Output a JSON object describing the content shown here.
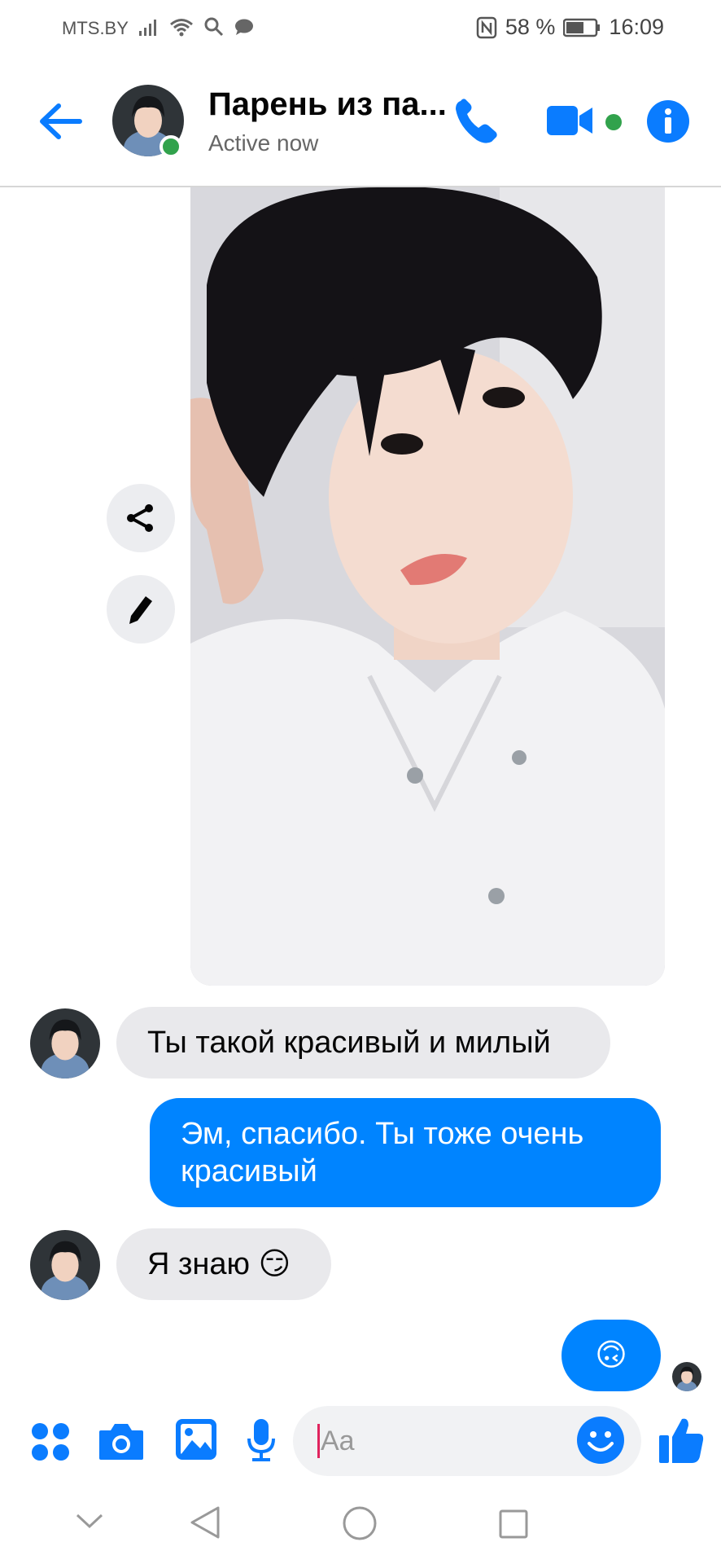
{
  "status_bar": {
    "carrier": "MTS.BY",
    "battery": "58 %",
    "time": "16:09"
  },
  "header": {
    "back_icon": "arrow-left-icon",
    "contact_name": "Парень из па...",
    "presence": "Active now",
    "call_icon": "phone-icon",
    "video_icon": "video-camera-icon",
    "info_icon": "info-icon"
  },
  "photo_actions": {
    "share_icon": "share-icon",
    "edit_icon": "pencil-icon"
  },
  "messages": [
    {
      "direction": "incoming",
      "text": "Ты такой красивый и милый"
    },
    {
      "direction": "outgoing",
      "line1": "Эм, спасибо. Ты тоже очень",
      "line2": "красивый"
    },
    {
      "direction": "incoming",
      "text": "Я знаю 😏"
    },
    {
      "direction": "outgoing",
      "text": "🙃"
    }
  ],
  "composer": {
    "placeholder": "Aa",
    "icons": [
      "apps-icon",
      "camera-icon",
      "gallery-icon",
      "microphone-icon",
      "emoji-icon",
      "thumbs-up-icon"
    ]
  },
  "colors": {
    "accent": "#0084ff",
    "online": "#31a24c",
    "incoming_bubble": "#e9e9ec"
  }
}
